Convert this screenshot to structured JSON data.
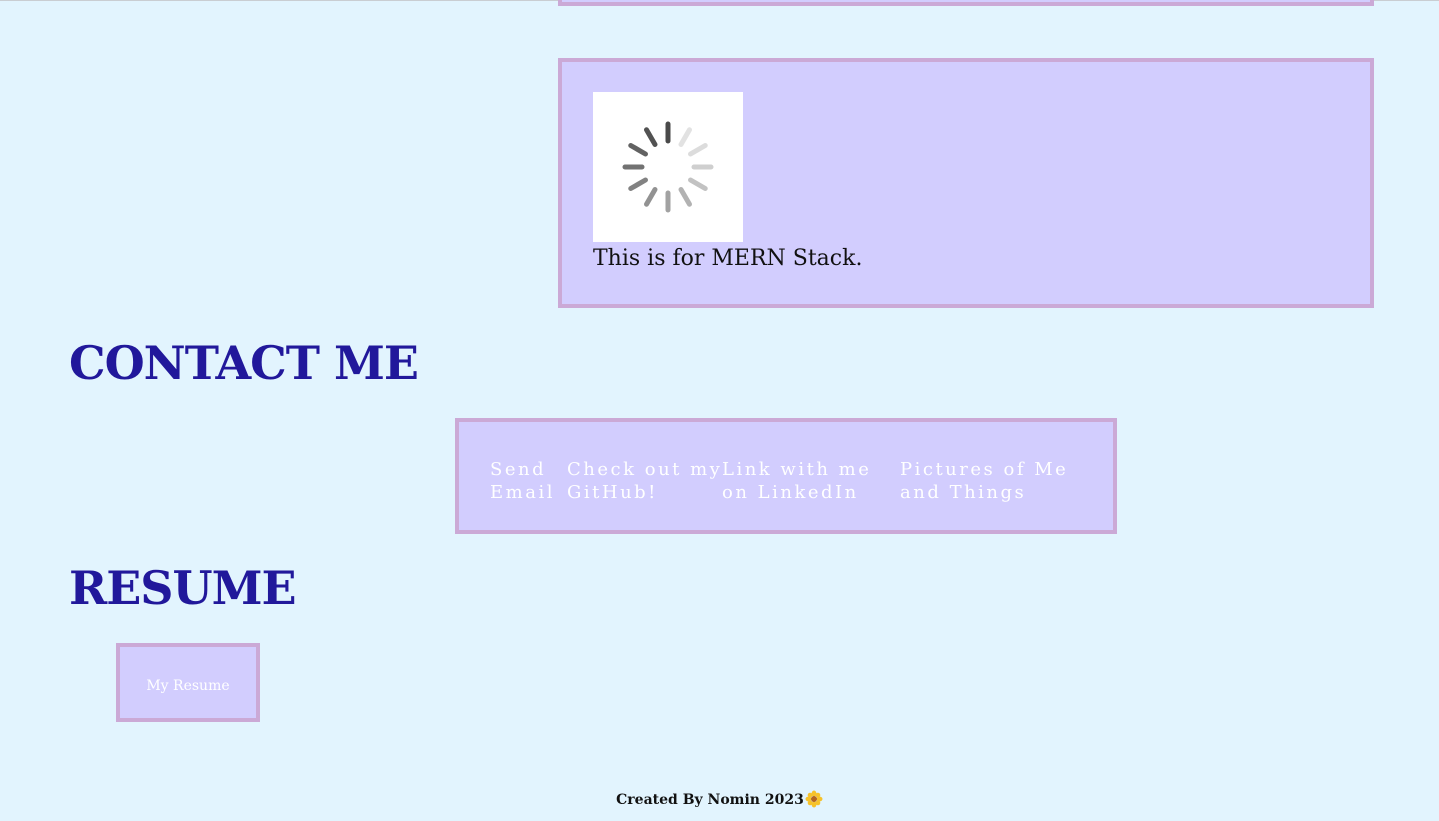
{
  "projects": {
    "card": {
      "image_icon": "loading-spinner-icon",
      "description": "This is for MERN Stack."
    }
  },
  "contact": {
    "title": "CONTACT ME",
    "links": [
      {
        "label": "Send Email"
      },
      {
        "label": "Check out my GitHub!"
      },
      {
        "label": "Link with me on LinkedIn"
      },
      {
        "label": "Pictures of Me and Things"
      }
    ]
  },
  "resume": {
    "title": "RESUME",
    "button_label": "My Resume"
  },
  "footer": {
    "text": "Created By Nomin 2023",
    "icon": "sunflower-icon"
  },
  "colors": {
    "background": "#e2f4fe",
    "card_fill": "#d2cdfe",
    "card_border": "#cba9d6",
    "heading": "#21189b",
    "link_text": "#ffffff"
  }
}
